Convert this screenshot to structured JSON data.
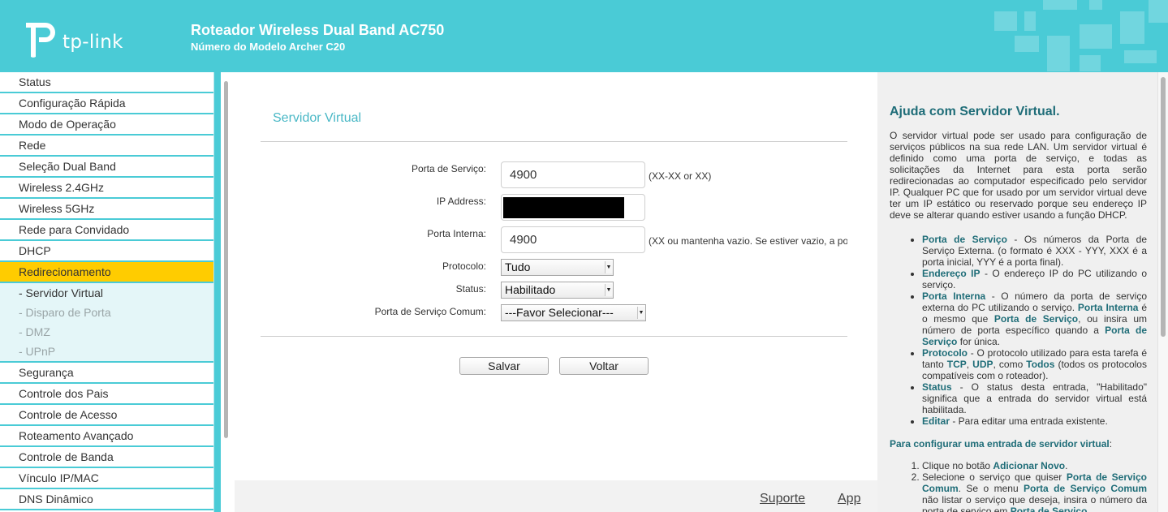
{
  "header": {
    "brand": "tp-link",
    "title": "Roteador Wireless Dual Band AC750",
    "subtitle": "Número do Modelo Archer C20",
    "accent_color": "#4acbd6"
  },
  "sidebar": {
    "items": [
      {
        "label": "Status"
      },
      {
        "label": "Configuração Rápida"
      },
      {
        "label": "Modo de Operação"
      },
      {
        "label": "Rede"
      },
      {
        "label": "Seleção Dual Band"
      },
      {
        "label": "Wireless 2.4GHz"
      },
      {
        "label": "Wireless 5GHz"
      },
      {
        "label": "Rede para Convidado"
      },
      {
        "label": "DHCP"
      },
      {
        "label": "Redirecionamento"
      }
    ],
    "submenu": [
      {
        "label": "- Servidor Virtual"
      },
      {
        "label": "- Disparo de Porta"
      },
      {
        "label": "- DMZ"
      },
      {
        "label": "- UPnP"
      }
    ],
    "items_after": [
      {
        "label": "Segurança"
      },
      {
        "label": "Controle dos Pais"
      },
      {
        "label": "Controle de Acesso"
      },
      {
        "label": "Roteamento Avançado"
      },
      {
        "label": "Controle de Banda"
      },
      {
        "label": "Vínculo IP/MAC"
      },
      {
        "label": "DNS Dinâmico"
      }
    ],
    "active_color": "#ffcc00"
  },
  "form": {
    "title": "Servidor Virtual",
    "service_port_label": "Porta de Serviço:",
    "service_port_value": "4900",
    "service_port_hint": "(XX-XX or XX)",
    "ip_label": "IP Address:",
    "internal_port_label": "Porta Interna:",
    "internal_port_value": "4900",
    "internal_port_hint": "(XX ou mantenha vazio. Se estiver vazio, a po",
    "protocol_label": "Protocolo:",
    "protocol_value": "Tudo",
    "status_label": "Status:",
    "status_value": "Habilitado",
    "common_port_label": "Porta de Serviço Comum:",
    "common_port_value": "---Favor Selecionar---",
    "save_label": "Salvar",
    "back_label": "Voltar"
  },
  "footer": {
    "support": "Suporte",
    "app": "App"
  },
  "help": {
    "title": "Ajuda com Servidor Virtual.",
    "intro": "O servidor virtual pode ser usado para configuração de serviços públicos na sua rede LAN. Um servidor virtual é definido como uma porta de serviço, e todas as solicitações da Internet para esta porta serão redirecionadas ao computador especificado pelo servidor IP. Qualquer PC que for usado por um servidor virtual deve ter um IP estático ou reservado porque seu endereço IP deve se alterar quando estiver usando a função DHCP.",
    "b1_term": "Porta de Serviço",
    "b1_text": " - Os números da Porta de Serviço Externa. (o formato é XXX - YYY, XXX é a porta inicial, YYY é a porta final).",
    "b2_term": "Endereço IP",
    "b2_text": " - O endereço IP do PC utilizando o serviço.",
    "b3_term": "Porta Interna",
    "b3_text_a": " - O número da porta de serviço externa do PC utilizando o serviço. ",
    "b3_term2": "Porta Interna",
    "b3_text_b": " é o mesmo que ",
    "b3_term3": "Porta de Serviço",
    "b3_text_c": ", ou insira um número de porta específico quando a ",
    "b3_term4": "Porta de Serviço",
    "b3_text_d": " for única.",
    "b4_term": "Protocolo",
    "b4_text_a": " - O protocolo utilizado para esta tarefa é tanto ",
    "b4_tcp": "TCP",
    "b4_comma": ", ",
    "b4_udp": "UDP",
    "b4_text_b": ", como ",
    "b4_all": "Todos",
    "b4_text_c": " (todos os protocolos compatíveis com o roteador).",
    "b5_term": "Status",
    "b5_text": " - O status desta entrada, \"Habilitado\" significa que a entrada do servidor virtual está habilitada.",
    "b6_term": "Editar",
    "b6_text": " - Para editar uma entrada existente.",
    "config_title": "Para configurar uma entrada de servidor virtual",
    "config_colon": ":",
    "s1_text": "Clique no botão ",
    "s1_term": "Adicionar Novo",
    "s1_end": ".",
    "s2_text": "Selecione o serviço que quiser ",
    "s2_term": "Porta de Serviço Comum",
    "s2_text_b": ". Se o menu ",
    "s2_term2": "Porta de Serviço Comum",
    "s2_text_c": " não listar o serviço que deseja, insira o número da porta de serviço em ",
    "s2_term3": "Porta de Serviço",
    "s2_end": "."
  }
}
